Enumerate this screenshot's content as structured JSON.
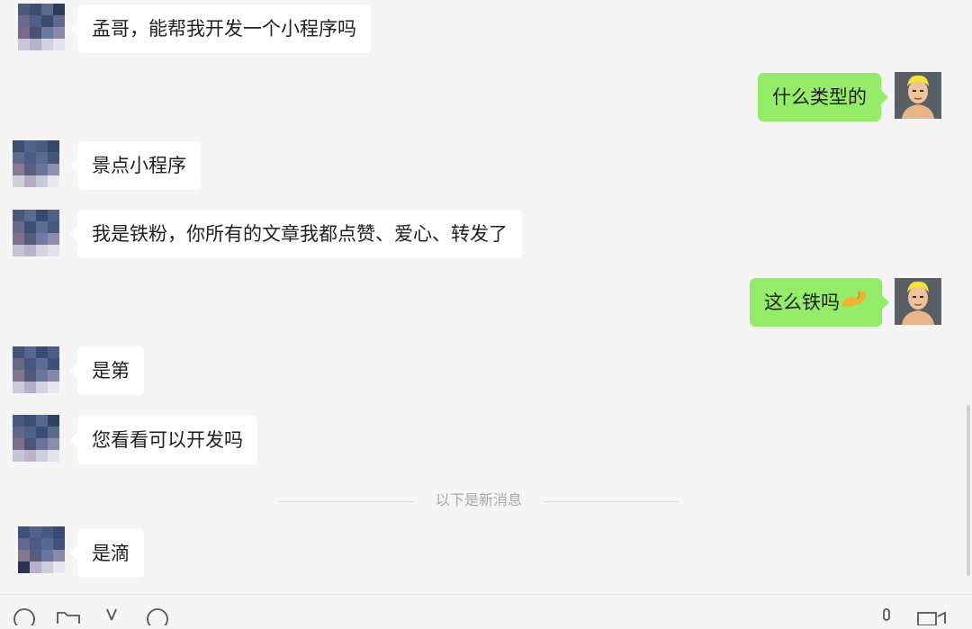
{
  "chat": {
    "messages": [
      {
        "side": "in",
        "text": "孟哥，能帮我开发一个小程序吗"
      },
      {
        "side": "out",
        "text": "什么类型的"
      },
      {
        "side": "in",
        "text": "景点小程序"
      },
      {
        "side": "in",
        "text": "我是铁粉，你所有的文章我都点赞、爱心、转发了"
      },
      {
        "side": "out",
        "text": "这么铁吗",
        "emoji": "strong-arm-emoji"
      },
      {
        "side": "in",
        "text": "是第"
      },
      {
        "side": "in",
        "text": "您看看可以开发吗"
      },
      {
        "side": "in",
        "text": "是滴"
      }
    ],
    "divider_text": "以下是新消息"
  },
  "toolbar": {
    "icons": [
      "emoji-icon",
      "folder-icon",
      "scissors-icon",
      "chat-history-icon",
      "microphone-icon",
      "video-call-icon"
    ]
  },
  "colors": {
    "background": "#f5f5f5",
    "incoming_bubble": "#ffffff",
    "outgoing_bubble": "#95ec69",
    "divider_text": "#a8a8a8"
  }
}
